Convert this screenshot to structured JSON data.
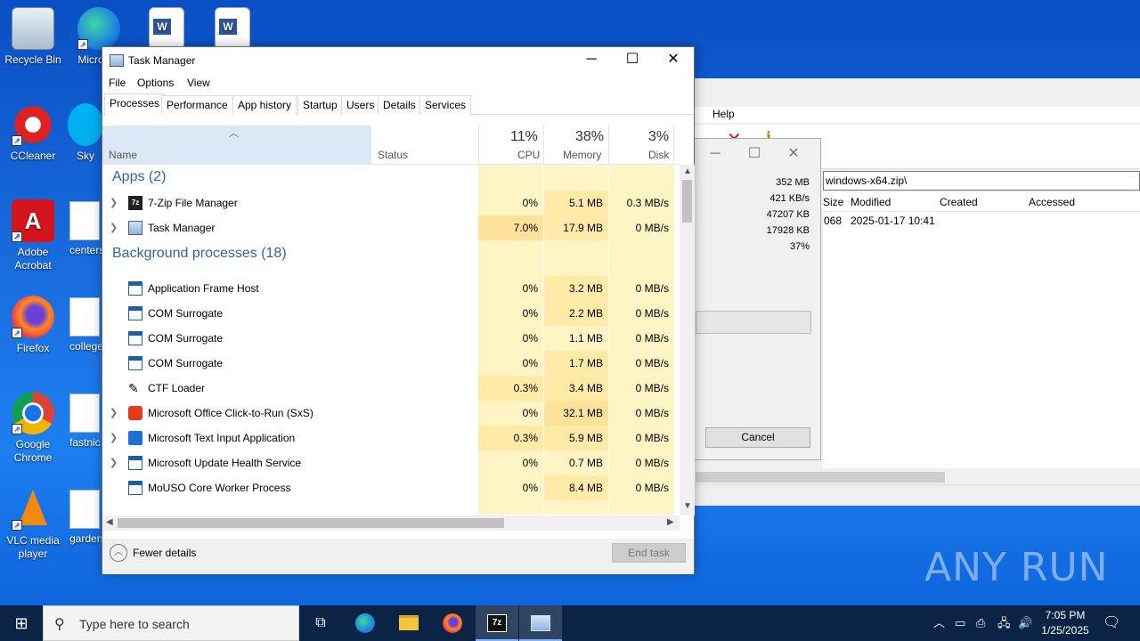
{
  "desktop": {
    "icons": [
      {
        "label": "Recycle Bin"
      },
      {
        "label": "Micro Ed"
      },
      {
        "label": "CCleaner"
      },
      {
        "label": "Sky"
      },
      {
        "label": "Adobe Acrobat"
      },
      {
        "label": "centers"
      },
      {
        "label": "Firefox"
      },
      {
        "label": "college"
      },
      {
        "label": "Google Chrome"
      },
      {
        "label": "fastnic"
      },
      {
        "label": "VLC media player"
      },
      {
        "label": "garden"
      }
    ]
  },
  "zip_window": {
    "menu_help": "Help",
    "address": "windows-x64.zip\\",
    "columns": [
      "Size",
      "Modified",
      "Created",
      "Accessed"
    ],
    "row": {
      "size": "068",
      "modified": "2025-01-17 10:41"
    }
  },
  "progress_dialog": {
    "stats": [
      "352 MB",
      "421 KB/s",
      "47207 KB",
      "17928 KB",
      "37%"
    ],
    "progress": 0.37,
    "cancel_label": "Cancel"
  },
  "task_manager": {
    "title": "Task Manager",
    "menu": [
      "File",
      "Options",
      "View"
    ],
    "tabs": [
      "Processes",
      "Performance",
      "App history",
      "Startup",
      "Users",
      "Details",
      "Services"
    ],
    "active_tab": "Processes",
    "columns": {
      "name": "Name",
      "status": "Status",
      "cpu_pct": "11%",
      "cpu": "CPU",
      "mem_pct": "38%",
      "mem": "Memory",
      "disk_pct": "3%",
      "disk": "Disk"
    },
    "groups": {
      "apps": "Apps (2)",
      "background": "Background processes (18)"
    },
    "apps": [
      {
        "name": "7-Zip File Manager",
        "cpu": "0%",
        "memory": "5.1 MB",
        "disk": "0.3 MB/s"
      },
      {
        "name": "Task Manager",
        "cpu": "7.0%",
        "memory": "17.9 MB",
        "disk": "0 MB/s"
      }
    ],
    "background": [
      {
        "name": "Application Frame Host",
        "cpu": "0%",
        "memory": "3.2 MB",
        "disk": "0 MB/s"
      },
      {
        "name": "COM Surrogate",
        "cpu": "0%",
        "memory": "2.2 MB",
        "disk": "0 MB/s"
      },
      {
        "name": "COM Surrogate",
        "cpu": "0%",
        "memory": "1.1 MB",
        "disk": "0 MB/s"
      },
      {
        "name": "COM Surrogate",
        "cpu": "0%",
        "memory": "1.7 MB",
        "disk": "0 MB/s"
      },
      {
        "name": "CTF Loader",
        "cpu": "0.3%",
        "memory": "3.4 MB",
        "disk": "0 MB/s"
      },
      {
        "name": "Microsoft Office Click-to-Run (SxS)",
        "cpu": "0%",
        "memory": "32.1 MB",
        "disk": "0 MB/s"
      },
      {
        "name": "Microsoft Text Input Application",
        "cpu": "0.3%",
        "memory": "5.9 MB",
        "disk": "0 MB/s"
      },
      {
        "name": "Microsoft Update Health Service",
        "cpu": "0%",
        "memory": "0.7 MB",
        "disk": "0 MB/s"
      },
      {
        "name": "MoUSO Core Worker Process",
        "cpu": "0%",
        "memory": "8.4 MB",
        "disk": "0 MB/s"
      }
    ],
    "fewer_details": "Fewer details",
    "end_task": "End task"
  },
  "taskbar": {
    "search_placeholder": "Type here to search",
    "time": "7:05 PM",
    "date": "1/25/2025"
  },
  "watermark": "ANY RUN"
}
